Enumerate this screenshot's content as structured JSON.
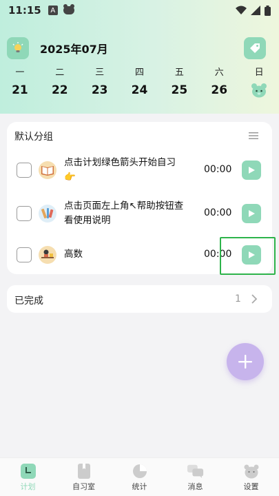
{
  "status_bar": {
    "time": "11:15",
    "notif_letter": "A"
  },
  "header": {
    "month": "2025年07月"
  },
  "week": {
    "days": [
      "一",
      "二",
      "三",
      "四",
      "五",
      "六",
      "日"
    ],
    "dates": [
      "21",
      "22",
      "23",
      "24",
      "25",
      "26",
      ""
    ]
  },
  "group": {
    "title": "默认分组",
    "tasks": [
      {
        "text": "点击计划绿色箭头开始自习",
        "emoji": "👉",
        "icon": "book-icon",
        "time": "00:00"
      },
      {
        "text": "点击页面左上角↖帮助按钮查看使用说明",
        "icon": "tools-icon",
        "time": "00:00"
      },
      {
        "text": "高数",
        "icon": "desk-study-icon",
        "time": "00:00"
      }
    ]
  },
  "completed": {
    "label": "已完成",
    "count": "1"
  },
  "tabs": [
    {
      "label": "计划",
      "icon": "plan-icon",
      "active": true
    },
    {
      "label": "自习室",
      "icon": "study-room-icon",
      "active": false
    },
    {
      "label": "统计",
      "icon": "pie-chart-icon",
      "active": false
    },
    {
      "label": "消息",
      "icon": "message-icon",
      "active": false
    },
    {
      "label": "设置",
      "icon": "bear-settings-icon",
      "active": false
    }
  ],
  "colors": {
    "accent": "#8fd8b8",
    "fab": "#c7b4ec",
    "highlight": "#2db34a"
  }
}
